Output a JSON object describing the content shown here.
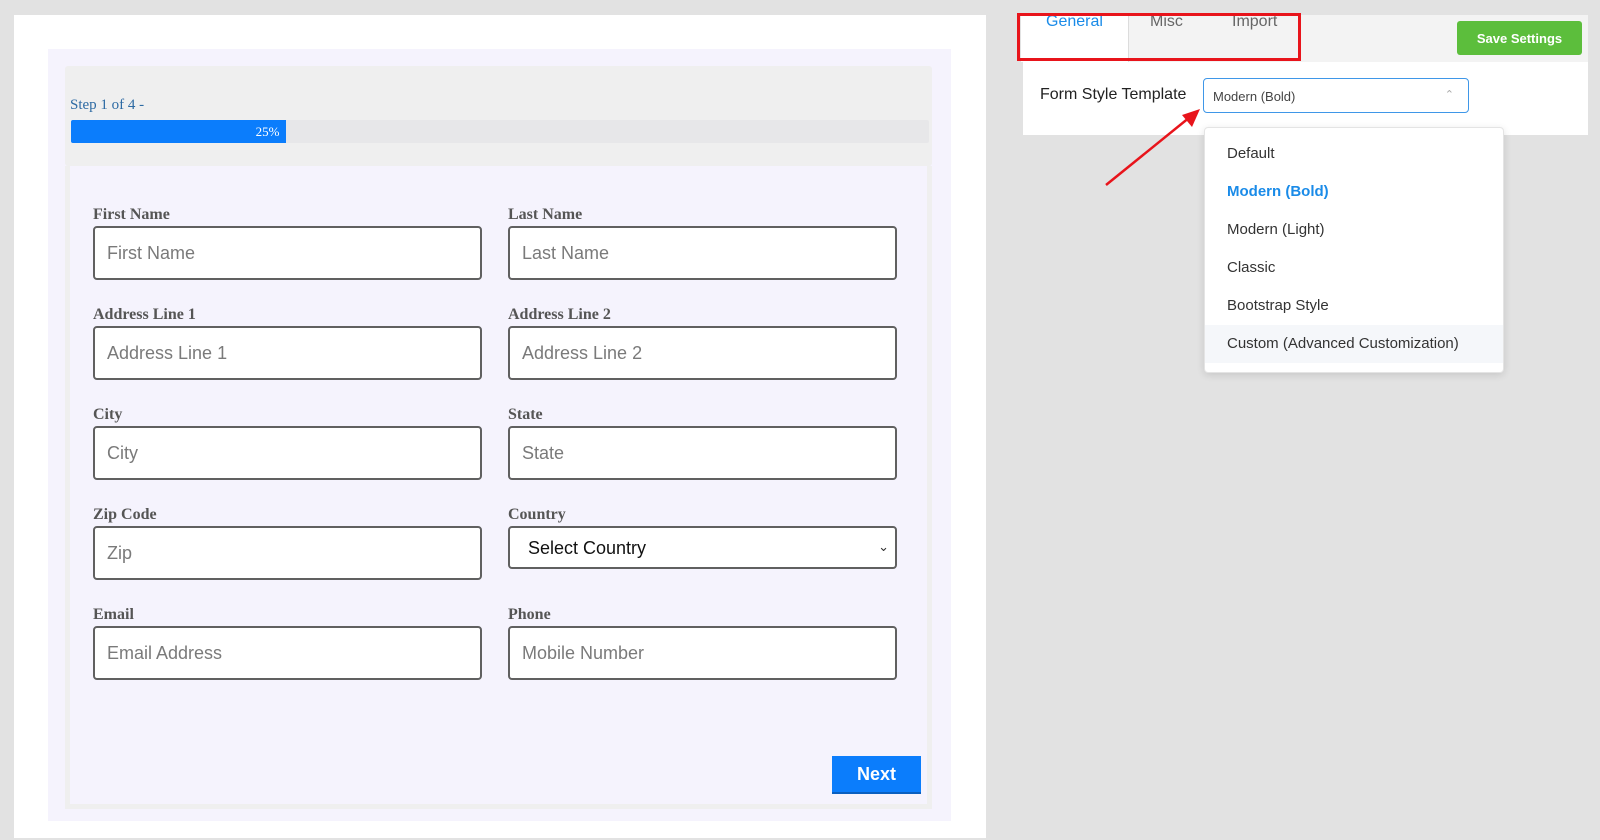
{
  "preview": {
    "step_text": "Step 1 of 4 -",
    "progress": {
      "percent": 25,
      "label": "25%"
    },
    "fields": [
      {
        "label": "First Name",
        "placeholder": "First Name",
        "type": "text"
      },
      {
        "label": "Last Name",
        "placeholder": "Last Name",
        "type": "text"
      },
      {
        "label": "Address Line 1",
        "placeholder": "Address Line 1",
        "type": "text"
      },
      {
        "label": "Address Line 2",
        "placeholder": "Address Line 2",
        "type": "text"
      },
      {
        "label": "City",
        "placeholder": "City",
        "type": "text"
      },
      {
        "label": "State",
        "placeholder": "State",
        "type": "text"
      },
      {
        "label": "Zip Code",
        "placeholder": "Zip",
        "type": "text"
      },
      {
        "label": "Country",
        "value": "Select Country",
        "type": "select"
      },
      {
        "label": "Email",
        "placeholder": "Email Address",
        "type": "text"
      },
      {
        "label": "Phone",
        "placeholder": "Mobile Number",
        "type": "text"
      }
    ],
    "next_label": "Next"
  },
  "settings": {
    "tabs": [
      {
        "label": "General",
        "active": true
      },
      {
        "label": "Misc",
        "active": false
      },
      {
        "label": "Import",
        "active": false
      }
    ],
    "save_label": "Save Settings",
    "form_style_label": "Form Style Template",
    "selected_value": "Modern (Bold)",
    "options": [
      {
        "label": "Default"
      },
      {
        "label": "Modern (Bold)",
        "selected": true
      },
      {
        "label": "Modern (Light)"
      },
      {
        "label": "Classic"
      },
      {
        "label": "Bootstrap Style"
      },
      {
        "label": "Custom (Advanced Customization)",
        "hover": true
      }
    ]
  },
  "colors": {
    "accent_blue": "#0b7dfc",
    "save_green": "#5cbe3c",
    "highlight_red": "#e8141b",
    "selected_option": "#1a8be8"
  },
  "icons": {
    "select_chevron": "chevron-down-icon",
    "dropdown_caret": "chevron-up-icon",
    "annotation": "red-arrow-icon"
  }
}
